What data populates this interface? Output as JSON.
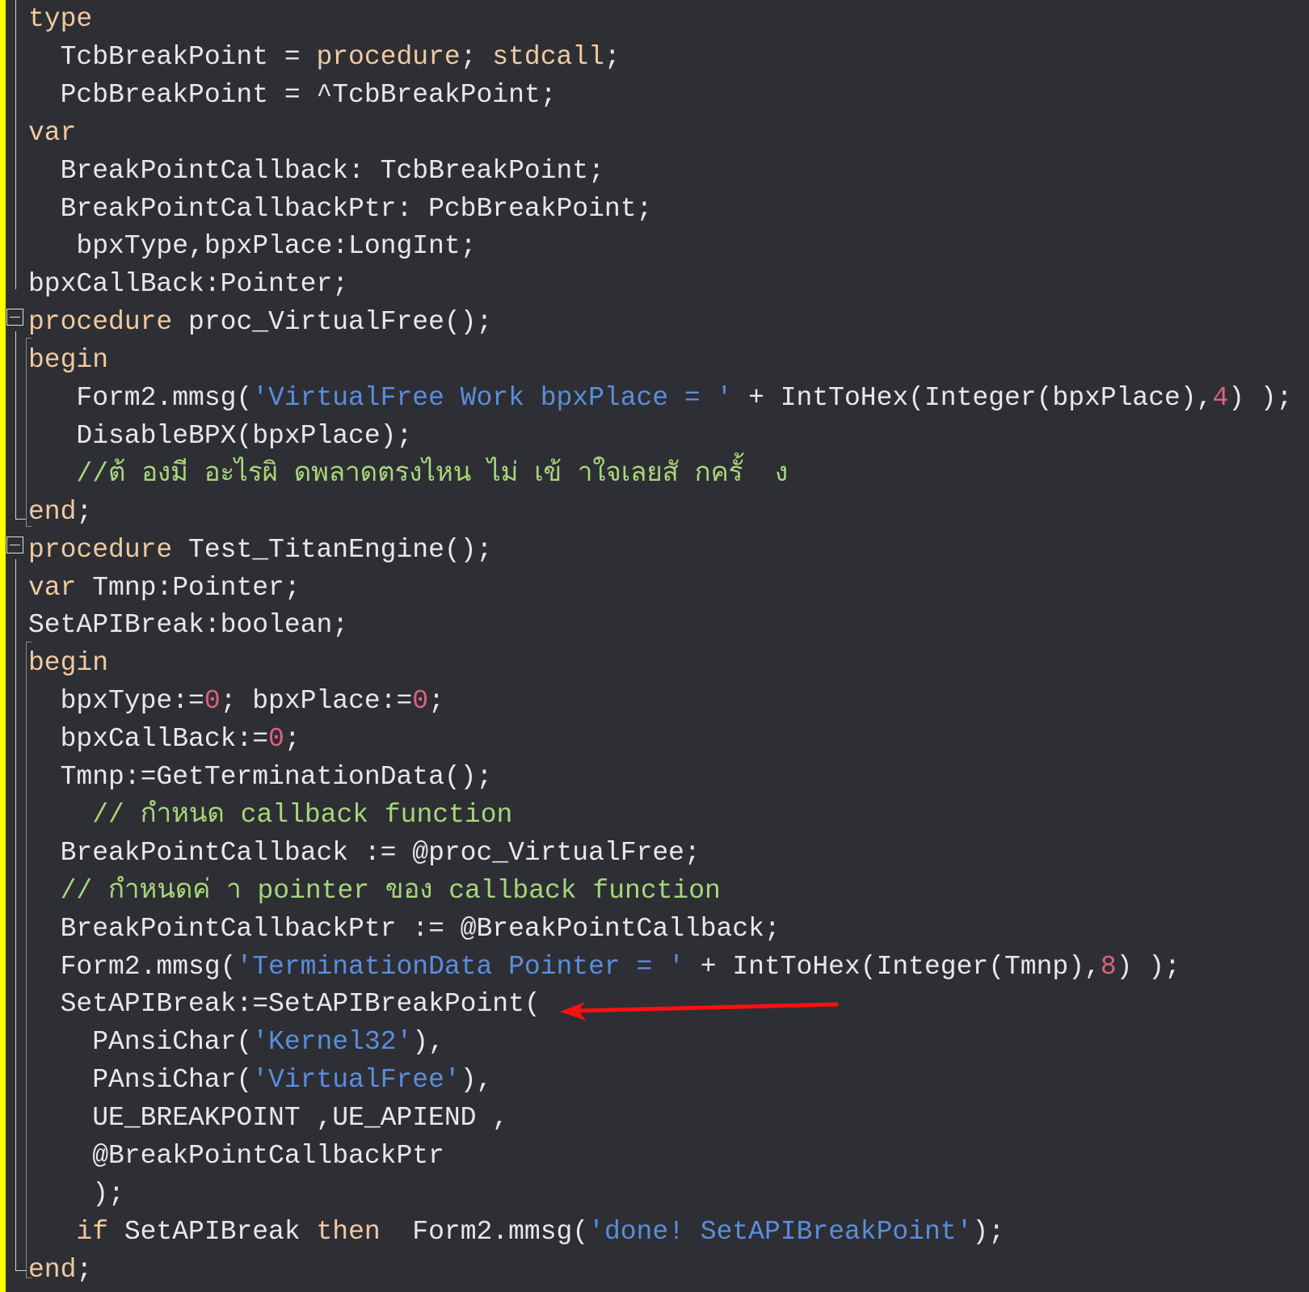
{
  "editor": {
    "language": "Delphi/Pascal",
    "colors": {
      "background": "#2d2f34",
      "gutter_marker": "#ffff00",
      "keyword": "#f2c9a0",
      "identifier": "#e8e8e8",
      "string": "#5b8ddd",
      "number": "#e0607e",
      "comment": "#a8d67a",
      "annotation_arrow": "#ff1010"
    },
    "lines": [
      {
        "indent": 0,
        "tokens": [
          [
            "kw",
            "type"
          ]
        ]
      },
      {
        "indent": 2,
        "tokens": [
          [
            "plain",
            "TcbBreakPoint = "
          ],
          [
            "kw",
            "procedure"
          ],
          [
            "plain",
            "; "
          ],
          [
            "kw",
            "stdcall"
          ],
          [
            "plain",
            ";"
          ]
        ]
      },
      {
        "indent": 2,
        "tokens": [
          [
            "plain",
            "PcbBreakPoint = ^TcbBreakPoint;"
          ]
        ]
      },
      {
        "indent": 0,
        "tokens": [
          [
            "kw",
            "var"
          ]
        ]
      },
      {
        "indent": 2,
        "tokens": [
          [
            "plain",
            "BreakPointCallback: TcbBreakPoint;"
          ]
        ]
      },
      {
        "indent": 2,
        "tokens": [
          [
            "plain",
            "BreakPointCallbackPtr: PcbBreakPoint;"
          ]
        ]
      },
      {
        "indent": 3,
        "tokens": [
          [
            "plain",
            "bpxType,bpxPlace:LongInt;"
          ]
        ]
      },
      {
        "indent": 0,
        "tokens": [
          [
            "plain",
            "bpxCallBack:Pointer;"
          ]
        ]
      },
      {
        "indent": 0,
        "tokens": [
          [
            "kw",
            "procedure"
          ],
          [
            "plain",
            " proc_VirtualFree();"
          ]
        ]
      },
      {
        "indent": 0,
        "tokens": [
          [
            "kw",
            "begin"
          ]
        ]
      },
      {
        "indent": 3,
        "tokens": [
          [
            "plain",
            "Form2.mmsg("
          ],
          [
            "str",
            "'VirtualFree Work bpxPlace = '"
          ],
          [
            "plain",
            " + IntToHex(Integer(bpxPlace),"
          ],
          [
            "num",
            "4"
          ],
          [
            "plain",
            ") );"
          ]
        ]
      },
      {
        "indent": 3,
        "tokens": [
          [
            "plain",
            "DisableBPX(bpxPlace);"
          ]
        ]
      },
      {
        "indent": 3,
        "tokens": [
          [
            "cmt",
            "//ต้ องมี อะไรผิ ดพลาดตรงไหน ไม่ เข้ าใจเลยสั กครั้  ง"
          ]
        ]
      },
      {
        "indent": 0,
        "tokens": [
          [
            "kw",
            "end"
          ],
          [
            "plain",
            ";"
          ]
        ]
      },
      {
        "indent": 0,
        "tokens": [
          [
            "kw",
            "procedure"
          ],
          [
            "plain",
            " Test_TitanEngine();"
          ]
        ]
      },
      {
        "indent": 0,
        "tokens": [
          [
            "kw",
            "var"
          ],
          [
            "plain",
            " Tmnp:Pointer;"
          ]
        ]
      },
      {
        "indent": 0,
        "tokens": [
          [
            "plain",
            "SetAPIBreak:boolean;"
          ]
        ]
      },
      {
        "indent": 0,
        "tokens": [
          [
            "kw",
            "begin"
          ]
        ]
      },
      {
        "indent": 2,
        "tokens": [
          [
            "plain",
            "bpxType:="
          ],
          [
            "num",
            "0"
          ],
          [
            "plain",
            "; bpxPlace:="
          ],
          [
            "num",
            "0"
          ],
          [
            "plain",
            ";"
          ]
        ]
      },
      {
        "indent": 2,
        "tokens": [
          [
            "plain",
            "bpxCallBack:="
          ],
          [
            "num",
            "0"
          ],
          [
            "plain",
            ";"
          ]
        ]
      },
      {
        "indent": 2,
        "tokens": [
          [
            "plain",
            "Tmnp:=GetTerminationData();"
          ]
        ]
      },
      {
        "indent": 4,
        "tokens": [
          [
            "cmt",
            "// กำหนด callback function"
          ]
        ]
      },
      {
        "indent": 2,
        "tokens": [
          [
            "plain",
            "BreakPointCallback := @proc_VirtualFree;"
          ]
        ]
      },
      {
        "indent": 2,
        "tokens": [
          [
            "cmt",
            "// กำหนดค่ า pointer ของ callback function"
          ]
        ]
      },
      {
        "indent": 2,
        "tokens": [
          [
            "plain",
            "BreakPointCallbackPtr := @BreakPointCallback;"
          ]
        ]
      },
      {
        "indent": 2,
        "tokens": [
          [
            "plain",
            "Form2.mmsg("
          ],
          [
            "str",
            "'TerminationData Pointer = '"
          ],
          [
            "plain",
            " + IntToHex(Integer(Tmnp),"
          ],
          [
            "num",
            "8"
          ],
          [
            "plain",
            ") );"
          ]
        ]
      },
      {
        "indent": 2,
        "tokens": [
          [
            "plain",
            "SetAPIBreak:=SetAPIBreakPoint("
          ]
        ]
      },
      {
        "indent": 4,
        "tokens": [
          [
            "plain",
            "PAnsiChar("
          ],
          [
            "str",
            "'Kernel32'"
          ],
          [
            "plain",
            "),"
          ]
        ]
      },
      {
        "indent": 4,
        "tokens": [
          [
            "plain",
            "PAnsiChar("
          ],
          [
            "str",
            "'VirtualFree'"
          ],
          [
            "plain",
            "),"
          ]
        ]
      },
      {
        "indent": 4,
        "tokens": [
          [
            "plain",
            "UE_BREAKPOINT ,UE_APIEND ,"
          ]
        ]
      },
      {
        "indent": 4,
        "tokens": [
          [
            "plain",
            "@BreakPointCallbackPtr"
          ]
        ]
      },
      {
        "indent": 4,
        "tokens": [
          [
            "plain",
            ");"
          ]
        ]
      },
      {
        "indent": 2,
        "tokens": [
          [
            "plain",
            " "
          ],
          [
            "kw",
            "if"
          ],
          [
            "plain",
            " SetAPIBreak "
          ],
          [
            "kw",
            "then"
          ],
          [
            "plain",
            "  Form2.mmsg("
          ],
          [
            "str",
            "'done! SetAPIBreakPoint'"
          ],
          [
            "plain",
            ");"
          ]
        ]
      },
      {
        "indent": 0,
        "tokens": [
          [
            "kw",
            "end"
          ],
          [
            "plain",
            ";"
          ]
        ]
      }
    ],
    "fold_markers": [
      {
        "line": 8,
        "label": "collapse-procedure-proc_VirtualFree"
      },
      {
        "line": 14,
        "label": "collapse-procedure-Test_TitanEngine"
      }
    ],
    "annotation": {
      "type": "red-arrow",
      "points_to_line": 26,
      "points_to_text": "SetAPIBreak:=SetAPIBreakPoint("
    }
  }
}
